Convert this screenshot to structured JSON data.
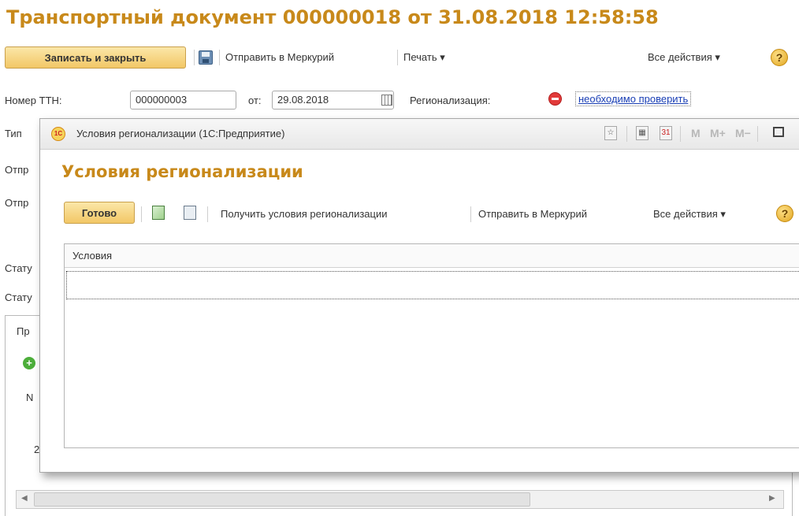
{
  "form": {
    "title": "Транспортный документ 000000018 от 31.08.2018 12:58:58",
    "toolbar": {
      "save_close_label": "Записать и закрыть",
      "send_mercury_label": "Отправить в Меркурий",
      "print_label": "Печать ▾",
      "all_actions_label": "Все действия ▾",
      "help_label": "?"
    },
    "ttn_label": "Номер ТТН:",
    "ttn_value": "000000003",
    "date_label": "от:",
    "date_value": "29.08.2018",
    "regionalization_label": "Регионализация:",
    "regionalization_status": "необходимо проверить",
    "left_labels": [
      "Тип",
      "Отпр",
      "Отпр",
      "Стату",
      "Стату"
    ],
    "tab_label": "Пр",
    "table_header_n": "N",
    "row_number": "2"
  },
  "modal": {
    "window_title": "Условия регионализации  (1С:Предприятие)",
    "heading": "Условия регионализации",
    "toolbar": {
      "done_label": "Готово",
      "get_conditions_label": "Получить условия регионализации",
      "send_mercury_label": "Отправить в Меркурий",
      "all_actions_label": "Все действия ▾",
      "help_label": "?"
    },
    "titlebar_buttons": {
      "calendar_label": "31",
      "m_label": "M",
      "m_plus_label": "M+",
      "m_minus_label": "M−"
    },
    "grid": {
      "column_header": "Условия",
      "rows": [
        ""
      ]
    }
  }
}
